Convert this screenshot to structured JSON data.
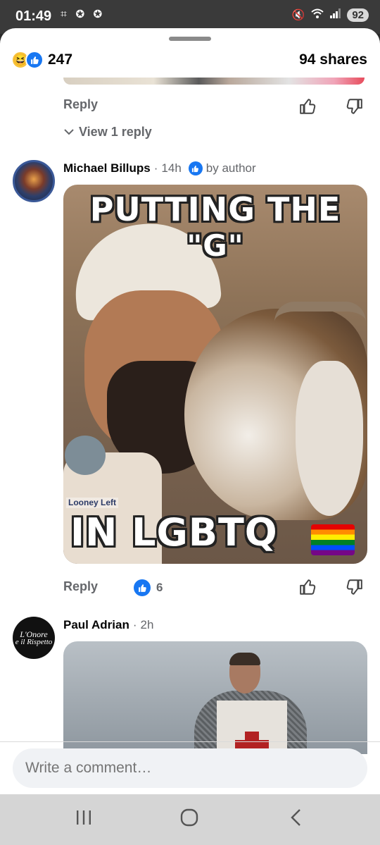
{
  "status_bar": {
    "time": "01:49",
    "left_icons": "⌗ ✪ ✪",
    "battery": "92"
  },
  "post_stats": {
    "reaction_count": "247",
    "shares": "94 shares"
  },
  "prev_comment": {
    "reply_label": "Reply",
    "view_replies": "View 1 reply"
  },
  "comments": [
    {
      "author": "Michael Billups",
      "time": "14h",
      "badge": "by author",
      "meme": {
        "line1": "PUTTING THE",
        "line2": "\"G\"",
        "line3": "IN LGBTQ",
        "watermark": "Looney Left"
      },
      "reply_label": "Reply",
      "like_count": "6"
    },
    {
      "author": "Paul Adrian",
      "time": "2h",
      "avatar_text_1": "L'Onore",
      "avatar_text_2": "e il Rispetto"
    }
  ],
  "composer": {
    "placeholder": "Write a comment…"
  },
  "colors": {
    "accent": "#1877f2",
    "text": "#050505",
    "muted": "#65676b"
  }
}
